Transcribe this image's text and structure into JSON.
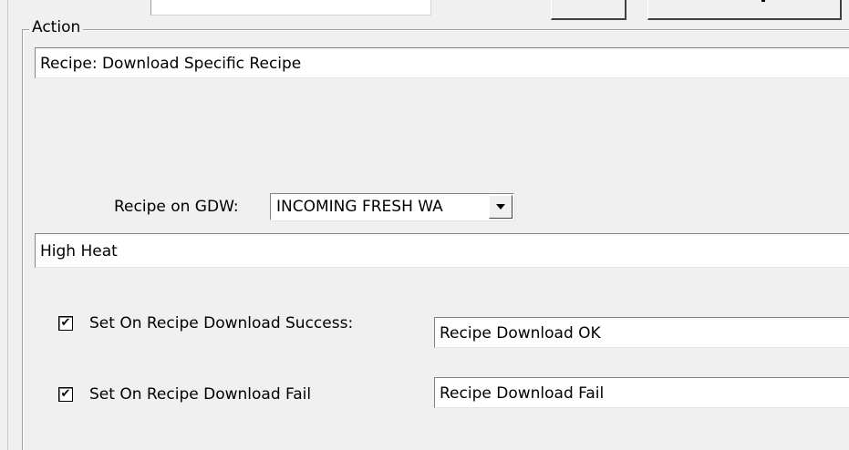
{
  "group": {
    "title": "Action"
  },
  "action_field": {
    "value": "Recipe: Download Specific Recipe"
  },
  "gdw": {
    "label": "Recipe on GDW:",
    "selected": "INCOMING FRESH WA"
  },
  "recipe_name_field": {
    "value": "High Heat"
  },
  "success": {
    "checked": true,
    "label": "Set On Recipe Download Success:",
    "value": "Recipe Download OK"
  },
  "fail": {
    "checked": true,
    "label": "Set On Recipe Download Fail",
    "value": "Recipe Download Fail"
  },
  "icons": {
    "check": "✔",
    "dropdown": "chevron-down-icon"
  }
}
